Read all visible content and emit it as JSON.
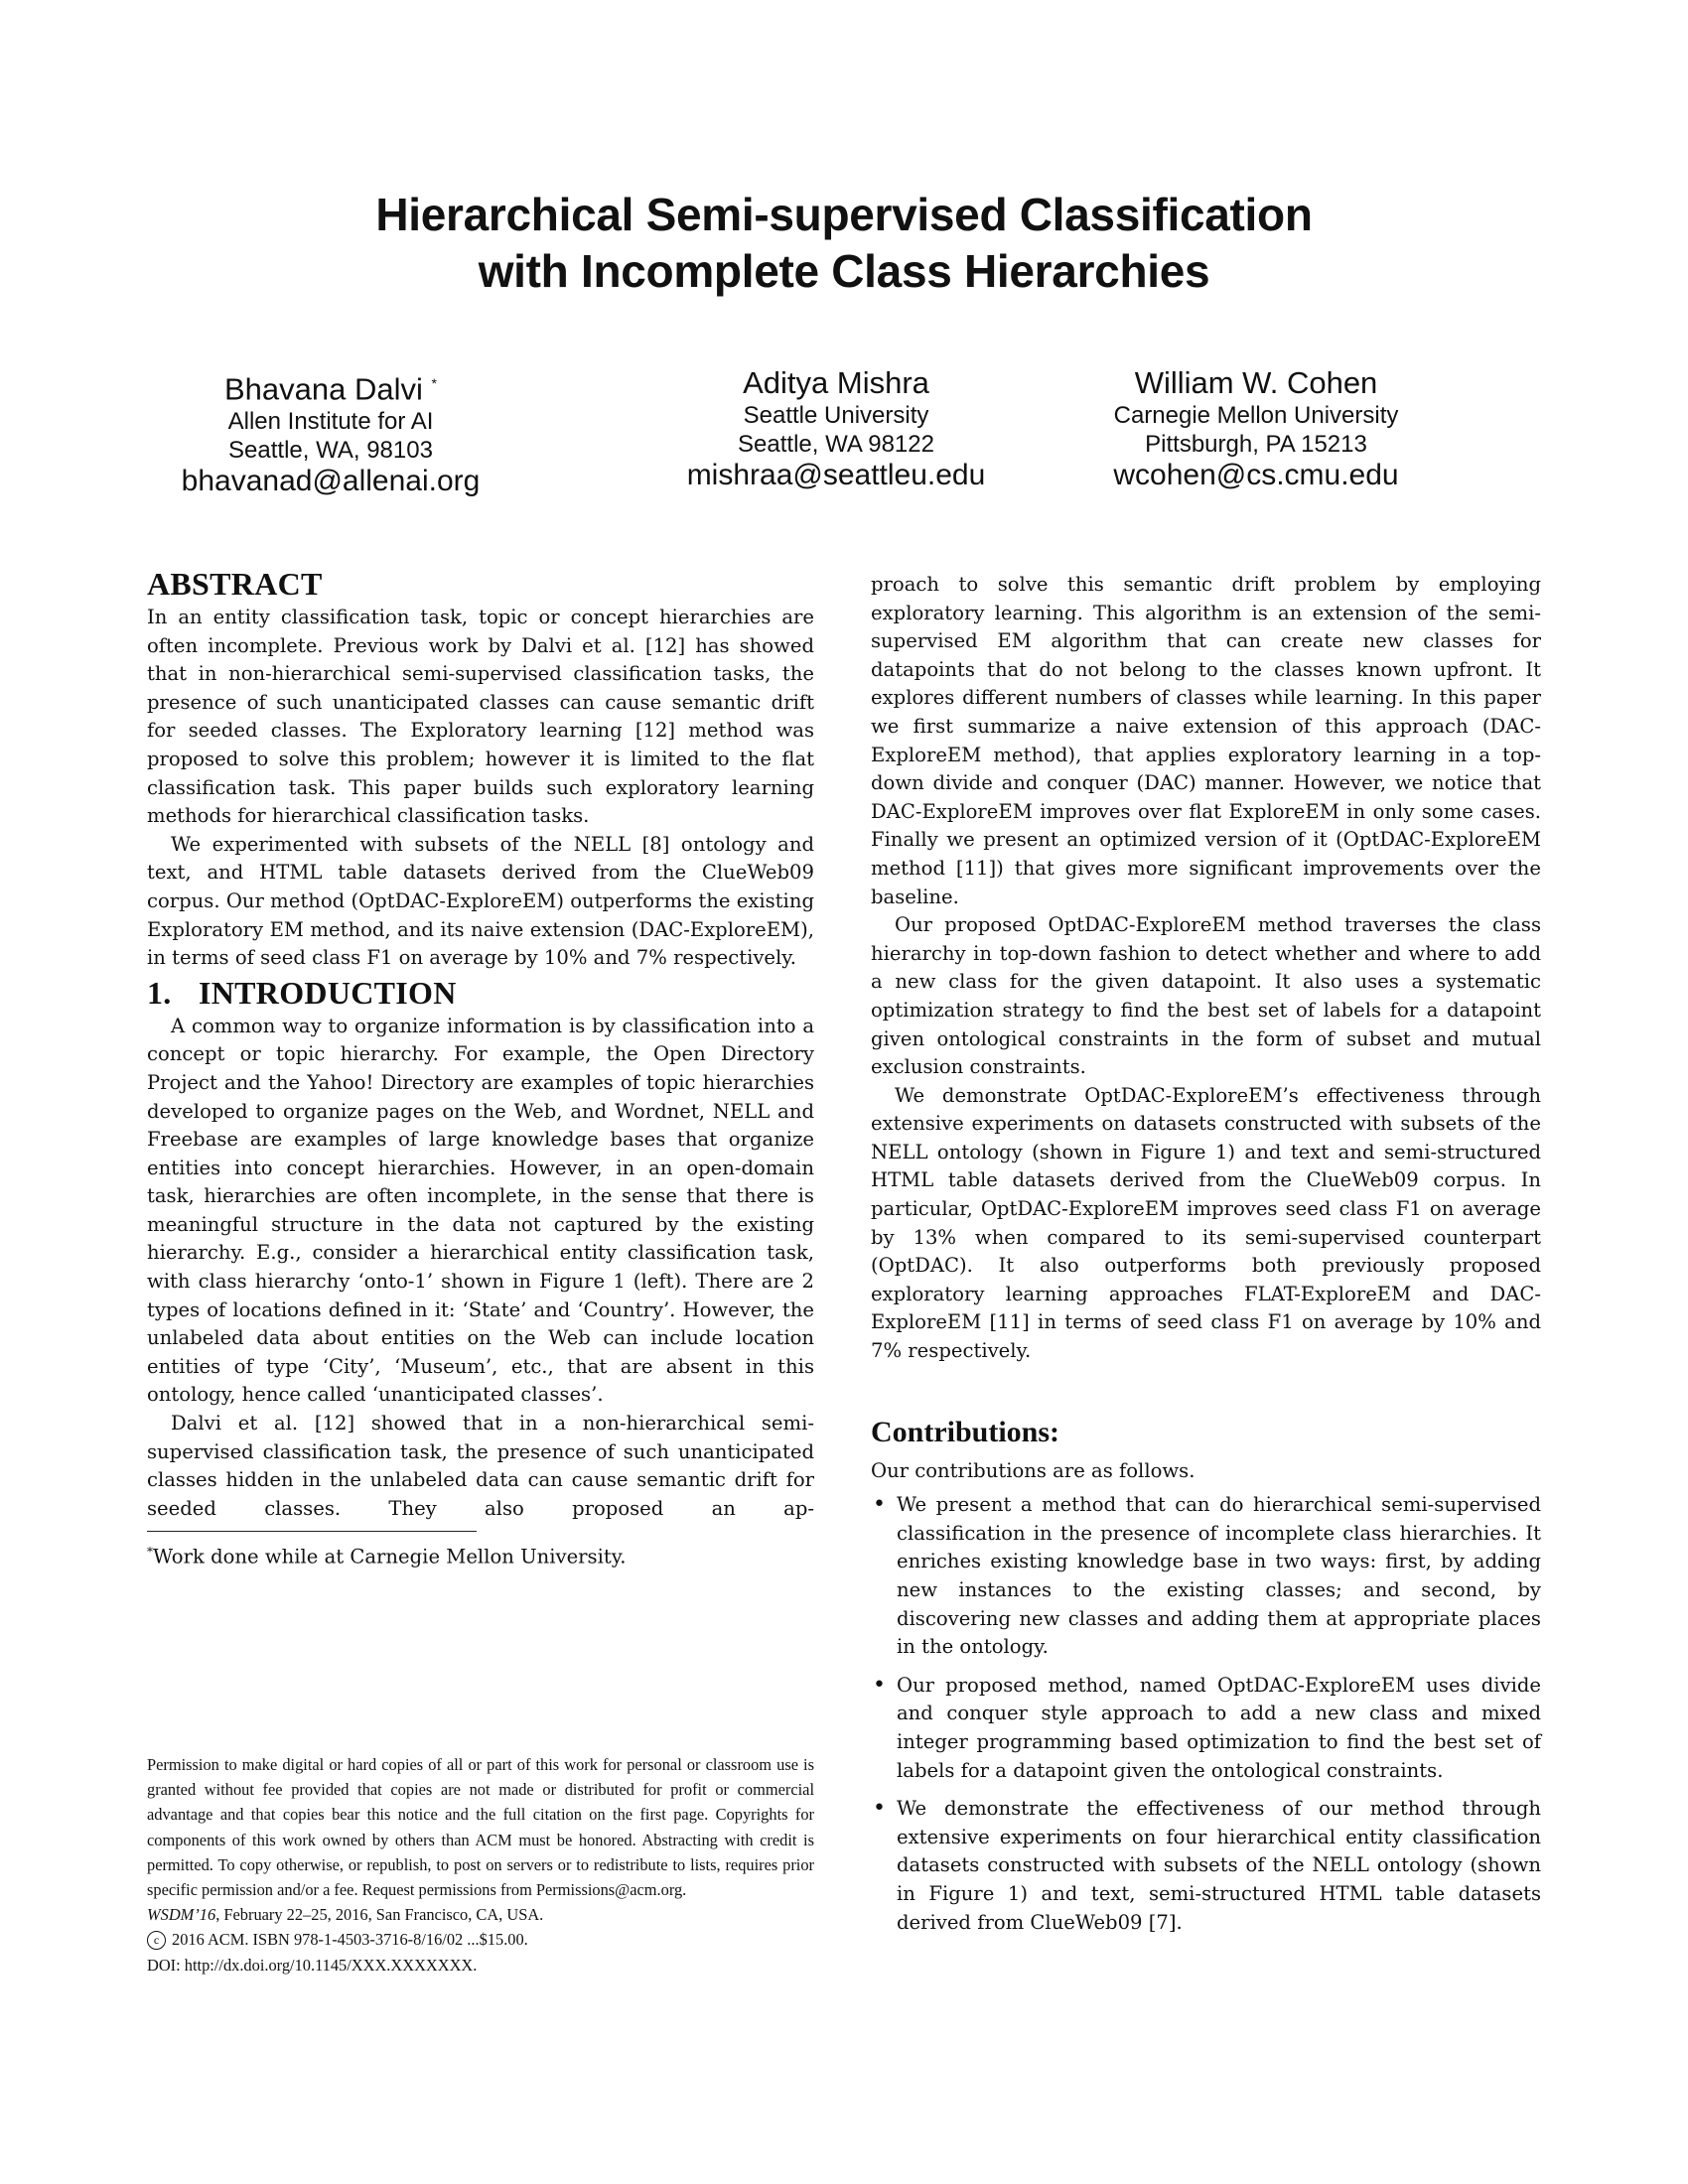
{
  "title": {
    "line1": "Hierarchical Semi-supervised Classification",
    "line2": "with Incomplete Class Hierarchies"
  },
  "authors": [
    {
      "name": "Bhavana Dalvi",
      "marker": "*",
      "affiliation": "Allen Institute for AI",
      "address": "Seattle, WA, 98103",
      "email": "bhavanad@allenai.org"
    },
    {
      "name": "Aditya Mishra",
      "marker": "",
      "affiliation": "Seattle University",
      "address": "Seattle, WA 98122",
      "email": "mishraa@seattleu.edu"
    },
    {
      "name": "William W. Cohen",
      "marker": "",
      "affiliation": "Carnegie Mellon University",
      "address": "Pittsburgh, PA 15213",
      "email": "wcohen@cs.cmu.edu"
    }
  ],
  "abstract": {
    "heading": "ABSTRACT",
    "paragraphs": [
      "In an entity classification task, topic or concept hierarchies are often incomplete. Previous work by Dalvi et al. [12] has showed that in non-hierarchical semi-supervised classifica­tion tasks, the presence of such unanticipated classes can cause semantic drift for seeded classes. The Exploratory learning [12] method was proposed to solve this problem; however it is limited to the flat classification task. This pa­per builds such exploratory learning methods for hierarchical classification tasks.",
      "We experimented with subsets of the NELL [8] ontol­ogy and text, and HTML table datasets derived from the ClueWeb09 corpus. Our method (OptDAC-ExploreEM) out­performs the existing Exploratory EM method, and its naive extension (DAC-ExploreEM), in terms of seed class F1 on average by 10% and 7% respectively."
    ]
  },
  "introduction": {
    "number": "1.",
    "heading": "INTRODUCTION",
    "paragraphs": [
      "A common way to organize information is by classifica­tion into a concept or topic hierarchy. For example, the Open Directory Project and the Yahoo! Directory are ex­amples of topic hierarchies developed to organize pages on the Web, and Wordnet, NELL and Freebase are examples of large knowledge bases that organize entities into concept hi­erarchies. However, in an open-domain task, hierarchies are often incomplete, in the sense that there is meaningful struc­ture in the data not captured by the existing hierarchy. E.g., consider a hierarchical entity classification task, with class hierarchy ‘onto-1’ shown in Figure 1 (left). There are 2 types of locations defined in it: ‘State’ and ‘Country’. However, the unlabeled data about entities on the Web can include lo­cation entities of type ‘City’, ‘Museum’, etc., that are absent in this ontology, hence called ‘unanticipated classes’.",
      "Dalvi et al. [12] showed that in a non-hierarchical semi-supervised classification task, the presence of such unantic­ipated classes hidden in the unlabeled data can cause se­mantic drift for seeded classes. They also proposed an ap­proach to solve this semantic drift problem by employing exploratory learning. This algorithm is an extension of the semi-supervised EM algorithm that can create new classes for datapoints that do not belong to the classes known up­front. It explores different numbers of classes while learning. In this paper we first summarize a naive extension of this ap­proach (DAC-ExploreEM method), that applies exploratory learning in a top-down divide and conquer (DAC) manner. However, we notice that DAC-ExploreEM improves over flat ExploreEM in only some cases. Finally we present an opti­mized version of it (OptDAC-ExploreEM method [11]) that gives more significant improvements over the baseline.",
      "Our proposed OptDAC-ExploreEM method traverses the class hierarchy in top-down fashion to detect whether and where to add a new class for the given datapoint. It also uses a systematic optimization strategy to find the best set of labels for a datapoint given ontological constraints in the form of subset and mutual exclusion constraints.",
      "We demonstrate OptDAC-ExploreEM’s effectiveness through extensive experiments on datasets constructed with subsets of the NELL ontology (shown in Figure 1) and text and semi-structured HTML table datasets derived from the ClueWeb09 corpus. In particular, OptDAC-ExploreEM im­proves seed class F1 on average by 13% when compared to its semi-supervised counterpart (OptDAC). It also outperforms both previously proposed exploratory learning approaches FLAT-ExploreEM and DAC-ExploreEM [11] in terms of seed class F1 on average by 10% and 7% respectively."
    ],
    "left_col_part2_split": "Dalvi et al. [12] showed that in a non-hierarchical semi-supervised classification task, the presence of such unantic­ipated classes hidden in the unlabeled data can cause se­mantic drift for seeded classes. They also proposed an ap-",
    "right_col_part2_cont": "proach to solve this semantic drift problem by employing exploratory learning. This algorithm is an extension of the semi-supervised EM algorithm that can create new classes for datapoints that do not belong to the classes known up­front. It explores different numbers of classes while learning. In this paper we first summarize a naive extension of this ap­proach (DAC-ExploreEM method), that applies exploratory learning in a top-down divide and conquer (DAC) manner. However, we notice that DAC-ExploreEM improves over flat ExploreEM in only some cases. Finally we present an opti­mized version of it (OptDAC-ExploreEM method [11]) that gives more significant improvements over the baseline."
  },
  "footnote": {
    "marker": "*",
    "text": "Work done while at Carnegie Mellon University."
  },
  "permission": {
    "text": "Permission to make digital or hard copies of all or part of this work for personal or classroom use is granted without fee provided that copies are not made or distributed for profit or commercial advantage and that copies bear this notice and the full cita­tion on the first page. Copyrights for components of this work owned by others than ACM must be honored. Abstracting with credit is permitted. To copy otherwise, or re­publish, to post on servers or to redistribute to lists, requires prior specific permission and/or a fee. Request permissions from Permissions@acm.org.",
    "venue_name": "WSDM’16",
    "venue_details": ", February 22–25, 2016, San Francisco, CA, USA.",
    "copyright_symbol": "c",
    "copyright": "2016 ACM. ISBN 978-1-4503-3716-8/16/02 ...$15.00.",
    "doi": "DOI: http://dx.doi.org/10.1145/XXX.XXXXXXX."
  },
  "contributions": {
    "heading": "Contributions:",
    "intro": "Our contributions are as follows.",
    "bullet_symbol": "•",
    "items": [
      "We present a method that can do hierarchical semi-supervised classification in the presence of incomplete class hierarchies. It enriches existing knowledge base in two ways: first, by adding new instances to the existing classes; and second, by discovering new classes and adding them at appropriate places in the ontology.",
      "Our proposed method, named OptDAC-ExploreEM uses divide and conquer style approach to add a new class and mixed integer programming based optimization to find the best set of labels for a datapoint given the ontological constraints.",
      "We demonstrate the effectiveness of our method through extensive experiments on four hierarchical entity classi­fication datasets constructed with subsets of the NELL ontology (shown in Figure 1) and text, semi-structured HTML table datasets derived from ClueWeb09 [7]."
    ]
  }
}
